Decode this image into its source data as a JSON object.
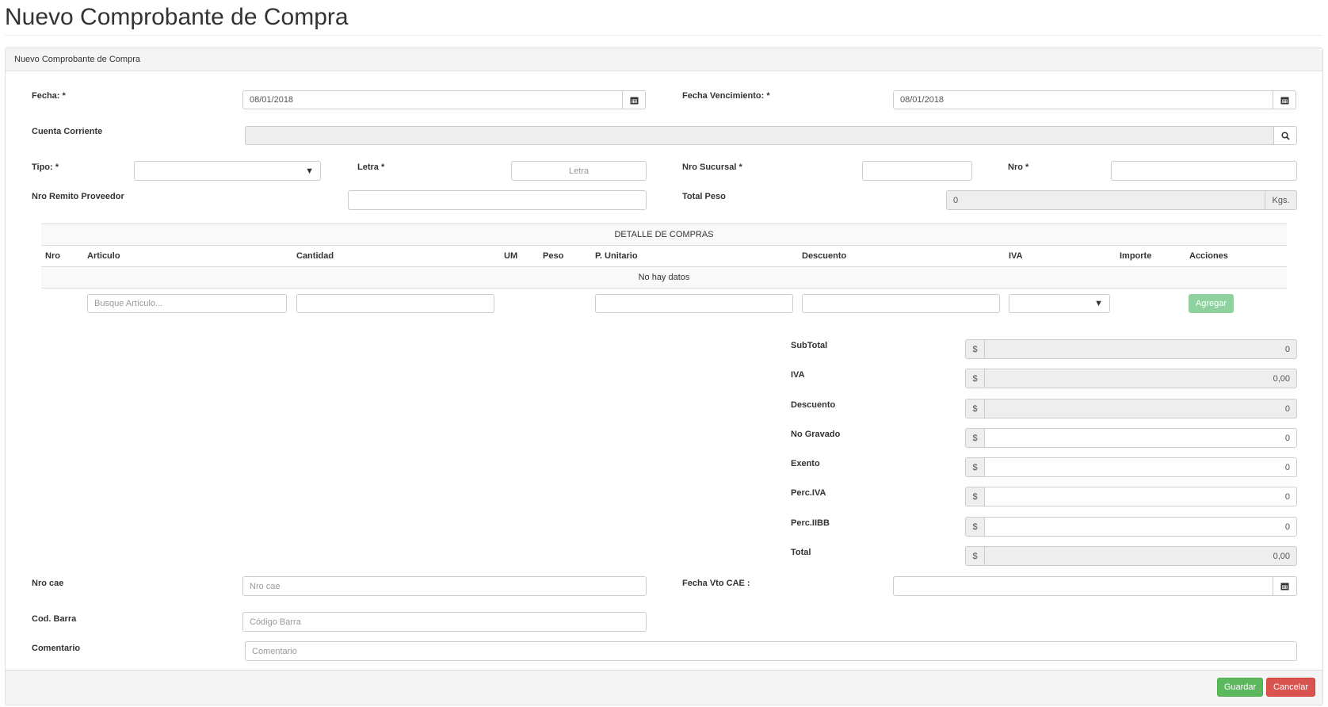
{
  "page": {
    "title": "Nuevo Comprobante de Compra"
  },
  "panel": {
    "heading": "Nuevo Comprobante de Compra"
  },
  "form": {
    "fecha": {
      "label": "Fecha: *",
      "value": "08/01/2018"
    },
    "fecha_vencimiento": {
      "label": "Fecha Vencimiento: *",
      "value": "08/01/2018"
    },
    "cuenta_corriente": {
      "label": "Cuenta Corriente",
      "value": ""
    },
    "tipo": {
      "label": "Tipo: *",
      "value": ""
    },
    "letra": {
      "label": "Letra *",
      "placeholder": "Letra"
    },
    "nro_sucursal": {
      "label": "Nro Sucursal *",
      "value": ""
    },
    "nro": {
      "label": "Nro *",
      "value": ""
    },
    "nro_remito": {
      "label": "Nro Remito Proveedor",
      "value": ""
    },
    "total_peso": {
      "label": "Total Peso",
      "value": "0",
      "unit": "Kgs."
    }
  },
  "detalle": {
    "title": "DETALLE DE COMPRAS",
    "columns": [
      "Nro",
      "Articulo",
      "Cantidad",
      "UM",
      "Peso",
      "P. Unitario",
      "Descuento",
      "IVA",
      "Importe",
      "Acciones"
    ],
    "empty_text": "No hay datos",
    "articulo_placeholder": "Busque Artículo...",
    "add_button": "Agregar"
  },
  "totals": {
    "currency": "$",
    "rows": [
      {
        "label": "SubTotal",
        "value": "0"
      },
      {
        "label": "IVA",
        "value": "0,00"
      },
      {
        "label": "Descuento",
        "value": "0"
      },
      {
        "label": "No Gravado",
        "value": "0"
      },
      {
        "label": "Exento",
        "value": "0"
      },
      {
        "label": "Perc.IVA",
        "value": "0"
      },
      {
        "label": "Perc.IIBB",
        "value": "0"
      },
      {
        "label": "Total",
        "value": "0,00"
      }
    ]
  },
  "bottom": {
    "nro_cae": {
      "label": "Nro cae",
      "placeholder": "Nro cae"
    },
    "fecha_vto_cae": {
      "label": "Fecha Vto CAE :",
      "value": ""
    },
    "cod_barra": {
      "label": "Cod. Barra",
      "placeholder": "Código Barra"
    },
    "comentario": {
      "label": "Comentario",
      "placeholder": "Comentario"
    }
  },
  "footer": {
    "save": "Guardar",
    "cancel": "Cancelar"
  }
}
